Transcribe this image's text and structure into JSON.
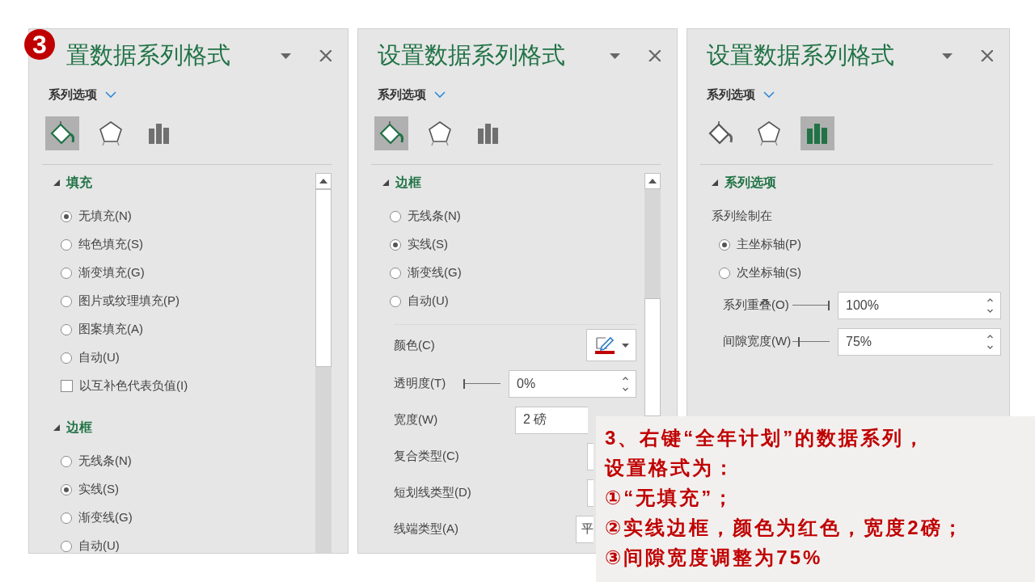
{
  "badge": "3",
  "panes": [
    {
      "title": "置数据系列格式",
      "menu": "系列选项",
      "scrollbar": true,
      "tabs": [
        {
          "kind": "fill",
          "selected": true
        },
        {
          "kind": "effects",
          "selected": false
        },
        {
          "kind": "series",
          "selected": false
        }
      ],
      "sections": [
        {
          "heading": "填充",
          "expanded": true,
          "items": [
            {
              "kind": "radio",
              "label": "无填充(N)",
              "selected": true
            },
            {
              "kind": "radio",
              "label": "纯色填充(S)",
              "selected": false
            },
            {
              "kind": "radio",
              "label": "渐变填充(G)",
              "selected": false
            },
            {
              "kind": "radio",
              "label": "图片或纹理填充(P)",
              "selected": false
            },
            {
              "kind": "radio",
              "label": "图案填充(A)",
              "selected": false
            },
            {
              "kind": "radio",
              "label": "自动(U)",
              "selected": false
            },
            {
              "kind": "checkbox",
              "label": "以互补色代表负值(I)",
              "checked": false
            }
          ]
        },
        {
          "heading": "边框",
          "expanded": true,
          "items": [
            {
              "kind": "radio",
              "label": "无线条(N)",
              "selected": false
            },
            {
              "kind": "radio",
              "label": "实线(S)",
              "selected": true
            },
            {
              "kind": "radio",
              "label": "渐变线(G)",
              "selected": false
            },
            {
              "kind": "radio",
              "label": "自动(U)",
              "selected": false
            }
          ]
        }
      ]
    },
    {
      "title": "设置数据系列格式",
      "menu": "系列选项",
      "scrollbar": true,
      "tabs": [
        {
          "kind": "fill",
          "selected": true
        },
        {
          "kind": "effects",
          "selected": false
        },
        {
          "kind": "series",
          "selected": false
        }
      ],
      "sections": [
        {
          "heading": "边框",
          "expanded": true,
          "items": [
            {
              "kind": "radio",
              "label": "无线条(N)",
              "selected": false
            },
            {
              "kind": "radio",
              "label": "实线(S)",
              "selected": true
            },
            {
              "kind": "radio",
              "label": "渐变线(G)",
              "selected": false
            },
            {
              "kind": "radio",
              "label": "自动(U)",
              "selected": false
            },
            {
              "kind": "divider"
            },
            {
              "kind": "color",
              "label": "颜色(C)",
              "color": "#c00000"
            },
            {
              "kind": "spin",
              "label": "透明度(T)",
              "value": "0%",
              "level": 0
            },
            {
              "kind": "spin",
              "label": "宽度(W)",
              "value": "2 磅"
            },
            {
              "kind": "dropdown",
              "label": "复合类型(C)"
            },
            {
              "kind": "dropdown",
              "label": "短划线类型(D)"
            },
            {
              "kind": "dropdown",
              "label": "线端类型(A)",
              "value": "平"
            }
          ]
        }
      ]
    },
    {
      "title": "设置数据系列格式",
      "menu": "系列选项",
      "scrollbar": false,
      "tabs": [
        {
          "kind": "fill",
          "selected": false
        },
        {
          "kind": "effects",
          "selected": false
        },
        {
          "kind": "series",
          "selected": true
        }
      ],
      "sections": [
        {
          "heading": "系列选项",
          "expanded": true,
          "items": [
            {
              "kind": "text",
              "label": "系列绘制在"
            },
            {
              "kind": "radio",
              "label": "主坐标轴(P)",
              "selected": true
            },
            {
              "kind": "radio",
              "label": "次坐标轴(S)",
              "selected": false
            },
            {
              "kind": "spin",
              "label": "系列重叠(O)",
              "value": "100%",
              "level": 1
            },
            {
              "kind": "spin",
              "label": "间隙宽度(W)",
              "value": "75%",
              "level": 0.15
            }
          ]
        }
      ]
    }
  ],
  "note": {
    "lines": [
      "3、右键“全年计划”的数据系列，",
      "设置格式为：",
      "①“无填充”；",
      "②实线边框，颜色为红色，宽度2磅；",
      "③间隙宽度调整为75%"
    ]
  }
}
